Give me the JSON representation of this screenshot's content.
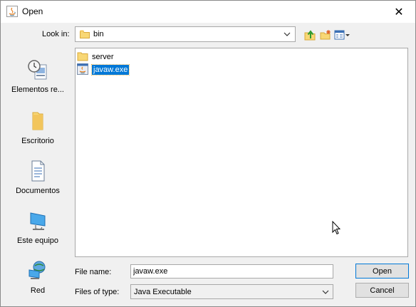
{
  "window": {
    "title": "Open",
    "close_glyph": "✕"
  },
  "toolbar": {
    "look_in_label": "Look in:",
    "look_in_value": "bin",
    "buttons": [
      {
        "name": "up-one-level-icon"
      },
      {
        "name": "new-folder-icon"
      },
      {
        "name": "view-menu-icon"
      }
    ]
  },
  "places": [
    {
      "label": "Elementos re...",
      "icon": "recent-items-icon"
    },
    {
      "label": "Escritorio",
      "icon": "desktop-folder-icon"
    },
    {
      "label": "Documentos",
      "icon": "documents-icon"
    },
    {
      "label": "Este equipo",
      "icon": "computer-icon"
    },
    {
      "label": "Red",
      "icon": "network-icon"
    }
  ],
  "files": [
    {
      "name": "server",
      "type": "folder",
      "selected": false
    },
    {
      "name": "javaw.exe",
      "type": "executable",
      "selected": true
    }
  ],
  "form": {
    "file_name_label": "File name:",
    "file_name_value": "javaw.exe",
    "file_type_label": "Files of type:",
    "file_type_value": "Java Executable"
  },
  "buttons": {
    "open": "Open",
    "cancel": "Cancel"
  },
  "colors": {
    "selection": "#0078d7",
    "window_bg": "#f0f0f0",
    "folder": "#f5d374"
  }
}
